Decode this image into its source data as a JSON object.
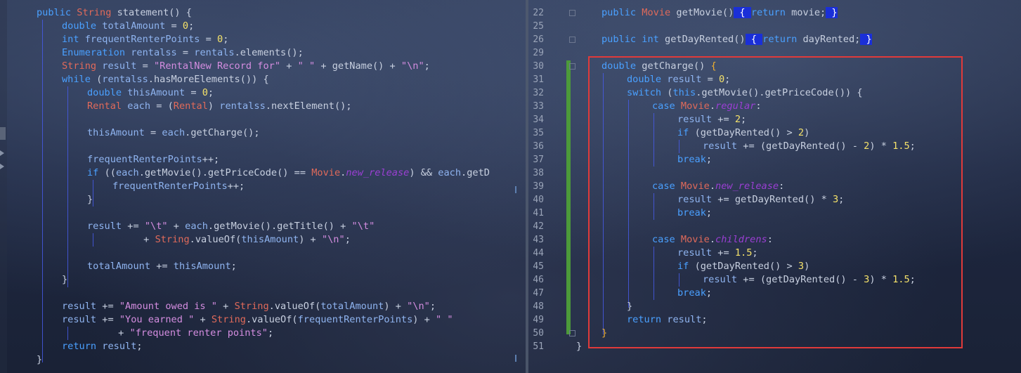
{
  "left": {
    "lines": [
      [
        [
          "kw",
          "public "
        ],
        [
          "type",
          "String "
        ],
        [
          "",
          "statement() {"
        ]
      ],
      [
        [
          "kw",
          "double "
        ],
        [
          "var",
          "totalAmount"
        ],
        [
          "",
          " = "
        ],
        [
          "num",
          "0"
        ],
        [
          "",
          ";"
        ]
      ],
      [
        [
          "kw",
          "int "
        ],
        [
          "var",
          "frequentRenterPoints"
        ],
        [
          "",
          " = "
        ],
        [
          "num",
          "0"
        ],
        [
          "",
          ";"
        ]
      ],
      [
        [
          "kw",
          "Enumeration "
        ],
        [
          "var",
          "rentalss"
        ],
        [
          "",
          " = "
        ],
        [
          "var",
          "rentals"
        ],
        [
          "",
          ".elements();"
        ]
      ],
      [
        [
          "type",
          "String "
        ],
        [
          "var",
          "result"
        ],
        [
          "",
          " = "
        ],
        [
          "str",
          "\"RentalNew Record for\""
        ],
        [
          "",
          " + "
        ],
        [
          "str",
          "\" \""
        ],
        [
          "",
          " + getName() + "
        ],
        [
          "str",
          "\"\\n\""
        ],
        [
          "",
          ";"
        ]
      ],
      [
        [
          "kw",
          "while "
        ],
        [
          "",
          "("
        ],
        [
          "var",
          "rentalss"
        ],
        [
          "",
          ".hasMoreElements()) {"
        ]
      ],
      [
        [
          "kw",
          "double "
        ],
        [
          "var",
          "thisAmount"
        ],
        [
          "",
          " = "
        ],
        [
          "num",
          "0"
        ],
        [
          "",
          ";"
        ]
      ],
      [
        [
          "type",
          "Rental "
        ],
        [
          "var",
          "each"
        ],
        [
          "",
          " = ("
        ],
        [
          "type",
          "Rental"
        ],
        [
          "",
          ") "
        ],
        [
          "var",
          "rentalss"
        ],
        [
          "",
          ".nextElement();"
        ]
      ],
      [],
      [
        [
          "var",
          "thisAmount"
        ],
        [
          "",
          " = "
        ],
        [
          "var",
          "each"
        ],
        [
          "",
          ".getCharge();"
        ]
      ],
      [],
      [
        [
          "var",
          "frequentRenterPoints"
        ],
        [
          "",
          "++;"
        ]
      ],
      [
        [
          "kw",
          "if "
        ],
        [
          "",
          "(("
        ],
        [
          "var",
          "each"
        ],
        [
          "",
          ".getMovie().getPriceCode() == "
        ],
        [
          "type",
          "Movie"
        ],
        [
          "",
          "."
        ],
        [
          "fld",
          "new_release"
        ],
        [
          "",
          ") && "
        ],
        [
          "var",
          "each"
        ],
        [
          "",
          ".getD"
        ]
      ],
      [
        [
          "var",
          "frequentRenterPoints"
        ],
        [
          "",
          "++;"
        ]
      ],
      [
        [
          "",
          "}"
        ]
      ],
      [],
      [
        [
          "var",
          "result"
        ],
        [
          "",
          " += "
        ],
        [
          "str",
          "\"\\t\""
        ],
        [
          "",
          " + "
        ],
        [
          "var",
          "each"
        ],
        [
          "",
          ".getMovie().getTitle() + "
        ],
        [
          "str",
          "\"\\t\""
        ]
      ],
      [
        [
          "",
          " + "
        ],
        [
          "type",
          "String"
        ],
        [
          "",
          ".valueOf("
        ],
        [
          "var",
          "thisAmount"
        ],
        [
          "",
          ") + "
        ],
        [
          "str",
          "\"\\n\""
        ],
        [
          "",
          ";"
        ]
      ],
      [],
      [
        [
          "var",
          "totalAmount"
        ],
        [
          "",
          " += "
        ],
        [
          "var",
          "thisAmount"
        ],
        [
          "",
          ";"
        ]
      ],
      [
        [
          "",
          "}"
        ]
      ],
      [],
      [
        [
          "var",
          "result"
        ],
        [
          "",
          " += "
        ],
        [
          "str",
          "\"Amount owed is \""
        ],
        [
          "",
          " + "
        ],
        [
          "type",
          "String"
        ],
        [
          "",
          ".valueOf("
        ],
        [
          "var",
          "totalAmount"
        ],
        [
          "",
          ") + "
        ],
        [
          "str",
          "\"\\n\""
        ],
        [
          "",
          ";"
        ]
      ],
      [
        [
          "var",
          "result"
        ],
        [
          "",
          " += "
        ],
        [
          "str",
          "\"You earned \""
        ],
        [
          "",
          " + "
        ],
        [
          "type",
          "String"
        ],
        [
          "",
          ".valueOf("
        ],
        [
          "var",
          "frequentRenterPoints"
        ],
        [
          "",
          ") + "
        ],
        [
          "str",
          "\" \""
        ]
      ],
      [
        [
          "",
          " + "
        ],
        [
          "str",
          "\"frequent renter points\""
        ],
        [
          "",
          ";"
        ]
      ],
      [
        [
          "kw",
          "return "
        ],
        [
          "var",
          "result"
        ],
        [
          "",
          ";"
        ]
      ],
      [
        [
          "",
          "}"
        ]
      ]
    ]
  },
  "right": {
    "line_numbers": [
      "22",
      "25",
      "26",
      "29",
      "30",
      "31",
      "32",
      "33",
      "34",
      "35",
      "36",
      "37",
      "38",
      "39",
      "40",
      "41",
      "42",
      "43",
      "44",
      "45",
      "46",
      "47",
      "48",
      "49",
      "50",
      "51"
    ],
    "lines": [
      [
        [
          "kw",
          "public "
        ],
        [
          "type",
          "Movie "
        ],
        [
          "",
          "getMovie()"
        ],
        [
          "hl",
          " { "
        ],
        [
          "kw",
          "return "
        ],
        [
          "",
          "movie;"
        ],
        [
          "hl",
          " }"
        ]
      ],
      [],
      [
        [
          "kw",
          "public int "
        ],
        [
          "",
          "getDayRented()"
        ],
        [
          "hl",
          " { "
        ],
        [
          "kw",
          "return "
        ],
        [
          "",
          "dayRented;"
        ],
        [
          "hl",
          " }"
        ]
      ],
      [],
      [
        [
          "kw",
          "double "
        ],
        [
          "",
          "getCharge() "
        ],
        [
          "brk",
          "{"
        ]
      ],
      [
        [
          "kw",
          "double "
        ],
        [
          "var",
          "result"
        ],
        [
          "",
          " = "
        ],
        [
          "num",
          "0"
        ],
        [
          "",
          ";"
        ]
      ],
      [
        [
          "kw",
          "switch "
        ],
        [
          "",
          "("
        ],
        [
          "kw",
          "this"
        ],
        [
          "",
          ".getMovie().getPriceCode()) {"
        ]
      ],
      [
        [
          "kw",
          "case "
        ],
        [
          "type",
          "Movie"
        ],
        [
          "",
          "."
        ],
        [
          "fld",
          "regular"
        ],
        [
          "",
          ":"
        ]
      ],
      [
        [
          "var",
          "result"
        ],
        [
          "",
          " += "
        ],
        [
          "num",
          "2"
        ],
        [
          "",
          ";"
        ]
      ],
      [
        [
          "kw",
          "if "
        ],
        [
          "",
          "(getDayRented() > "
        ],
        [
          "num",
          "2"
        ],
        [
          "",
          ")"
        ]
      ],
      [
        [
          "var",
          "result"
        ],
        [
          "",
          " += (getDayRented() - "
        ],
        [
          "num",
          "2"
        ],
        [
          "",
          ") * "
        ],
        [
          "num",
          "1.5"
        ],
        [
          "",
          ";"
        ]
      ],
      [
        [
          "kw",
          "break"
        ],
        [
          "",
          ";"
        ]
      ],
      [],
      [
        [
          "kw",
          "case "
        ],
        [
          "type",
          "Movie"
        ],
        [
          "",
          "."
        ],
        [
          "fld",
          "new_release"
        ],
        [
          "",
          ":"
        ]
      ],
      [
        [
          "var",
          "result"
        ],
        [
          "",
          " += getDayRented() * "
        ],
        [
          "num",
          "3"
        ],
        [
          "",
          ";"
        ]
      ],
      [
        [
          "kw",
          "break"
        ],
        [
          "",
          ";"
        ]
      ],
      [],
      [
        [
          "kw",
          "case "
        ],
        [
          "type",
          "Movie"
        ],
        [
          "",
          "."
        ],
        [
          "fld",
          "childrens"
        ],
        [
          "",
          ":"
        ]
      ],
      [
        [
          "var",
          "result"
        ],
        [
          "",
          " += "
        ],
        [
          "num",
          "1.5"
        ],
        [
          "",
          ";"
        ]
      ],
      [
        [
          "kw",
          "if "
        ],
        [
          "",
          "(getDayRented() > "
        ],
        [
          "num",
          "3"
        ],
        [
          "",
          ")"
        ]
      ],
      [
        [
          "var",
          "result"
        ],
        [
          "",
          " += (getDayRented() - "
        ],
        [
          "num",
          "3"
        ],
        [
          "",
          ") * "
        ],
        [
          "num",
          "1.5"
        ],
        [
          "",
          ";"
        ]
      ],
      [
        [
          "kw",
          "break"
        ],
        [
          "",
          ";"
        ]
      ],
      [
        [
          "",
          "}"
        ]
      ],
      [
        [
          "kw",
          "return "
        ],
        [
          "var",
          "result"
        ],
        [
          "",
          ";"
        ]
      ],
      [
        [
          "brk",
          "}"
        ]
      ],
      [
        [
          "",
          "}"
        ]
      ]
    ]
  },
  "colors": {
    "keyword": "#4aa0ff",
    "type": "#e06a5a",
    "string": "#d48de0",
    "number": "#f5e26a",
    "field": "#9b3fd4",
    "brace_highlight": "#1a2fd8",
    "annotation_box": "#e03a3a",
    "change_bar": "#4c9a3a"
  }
}
